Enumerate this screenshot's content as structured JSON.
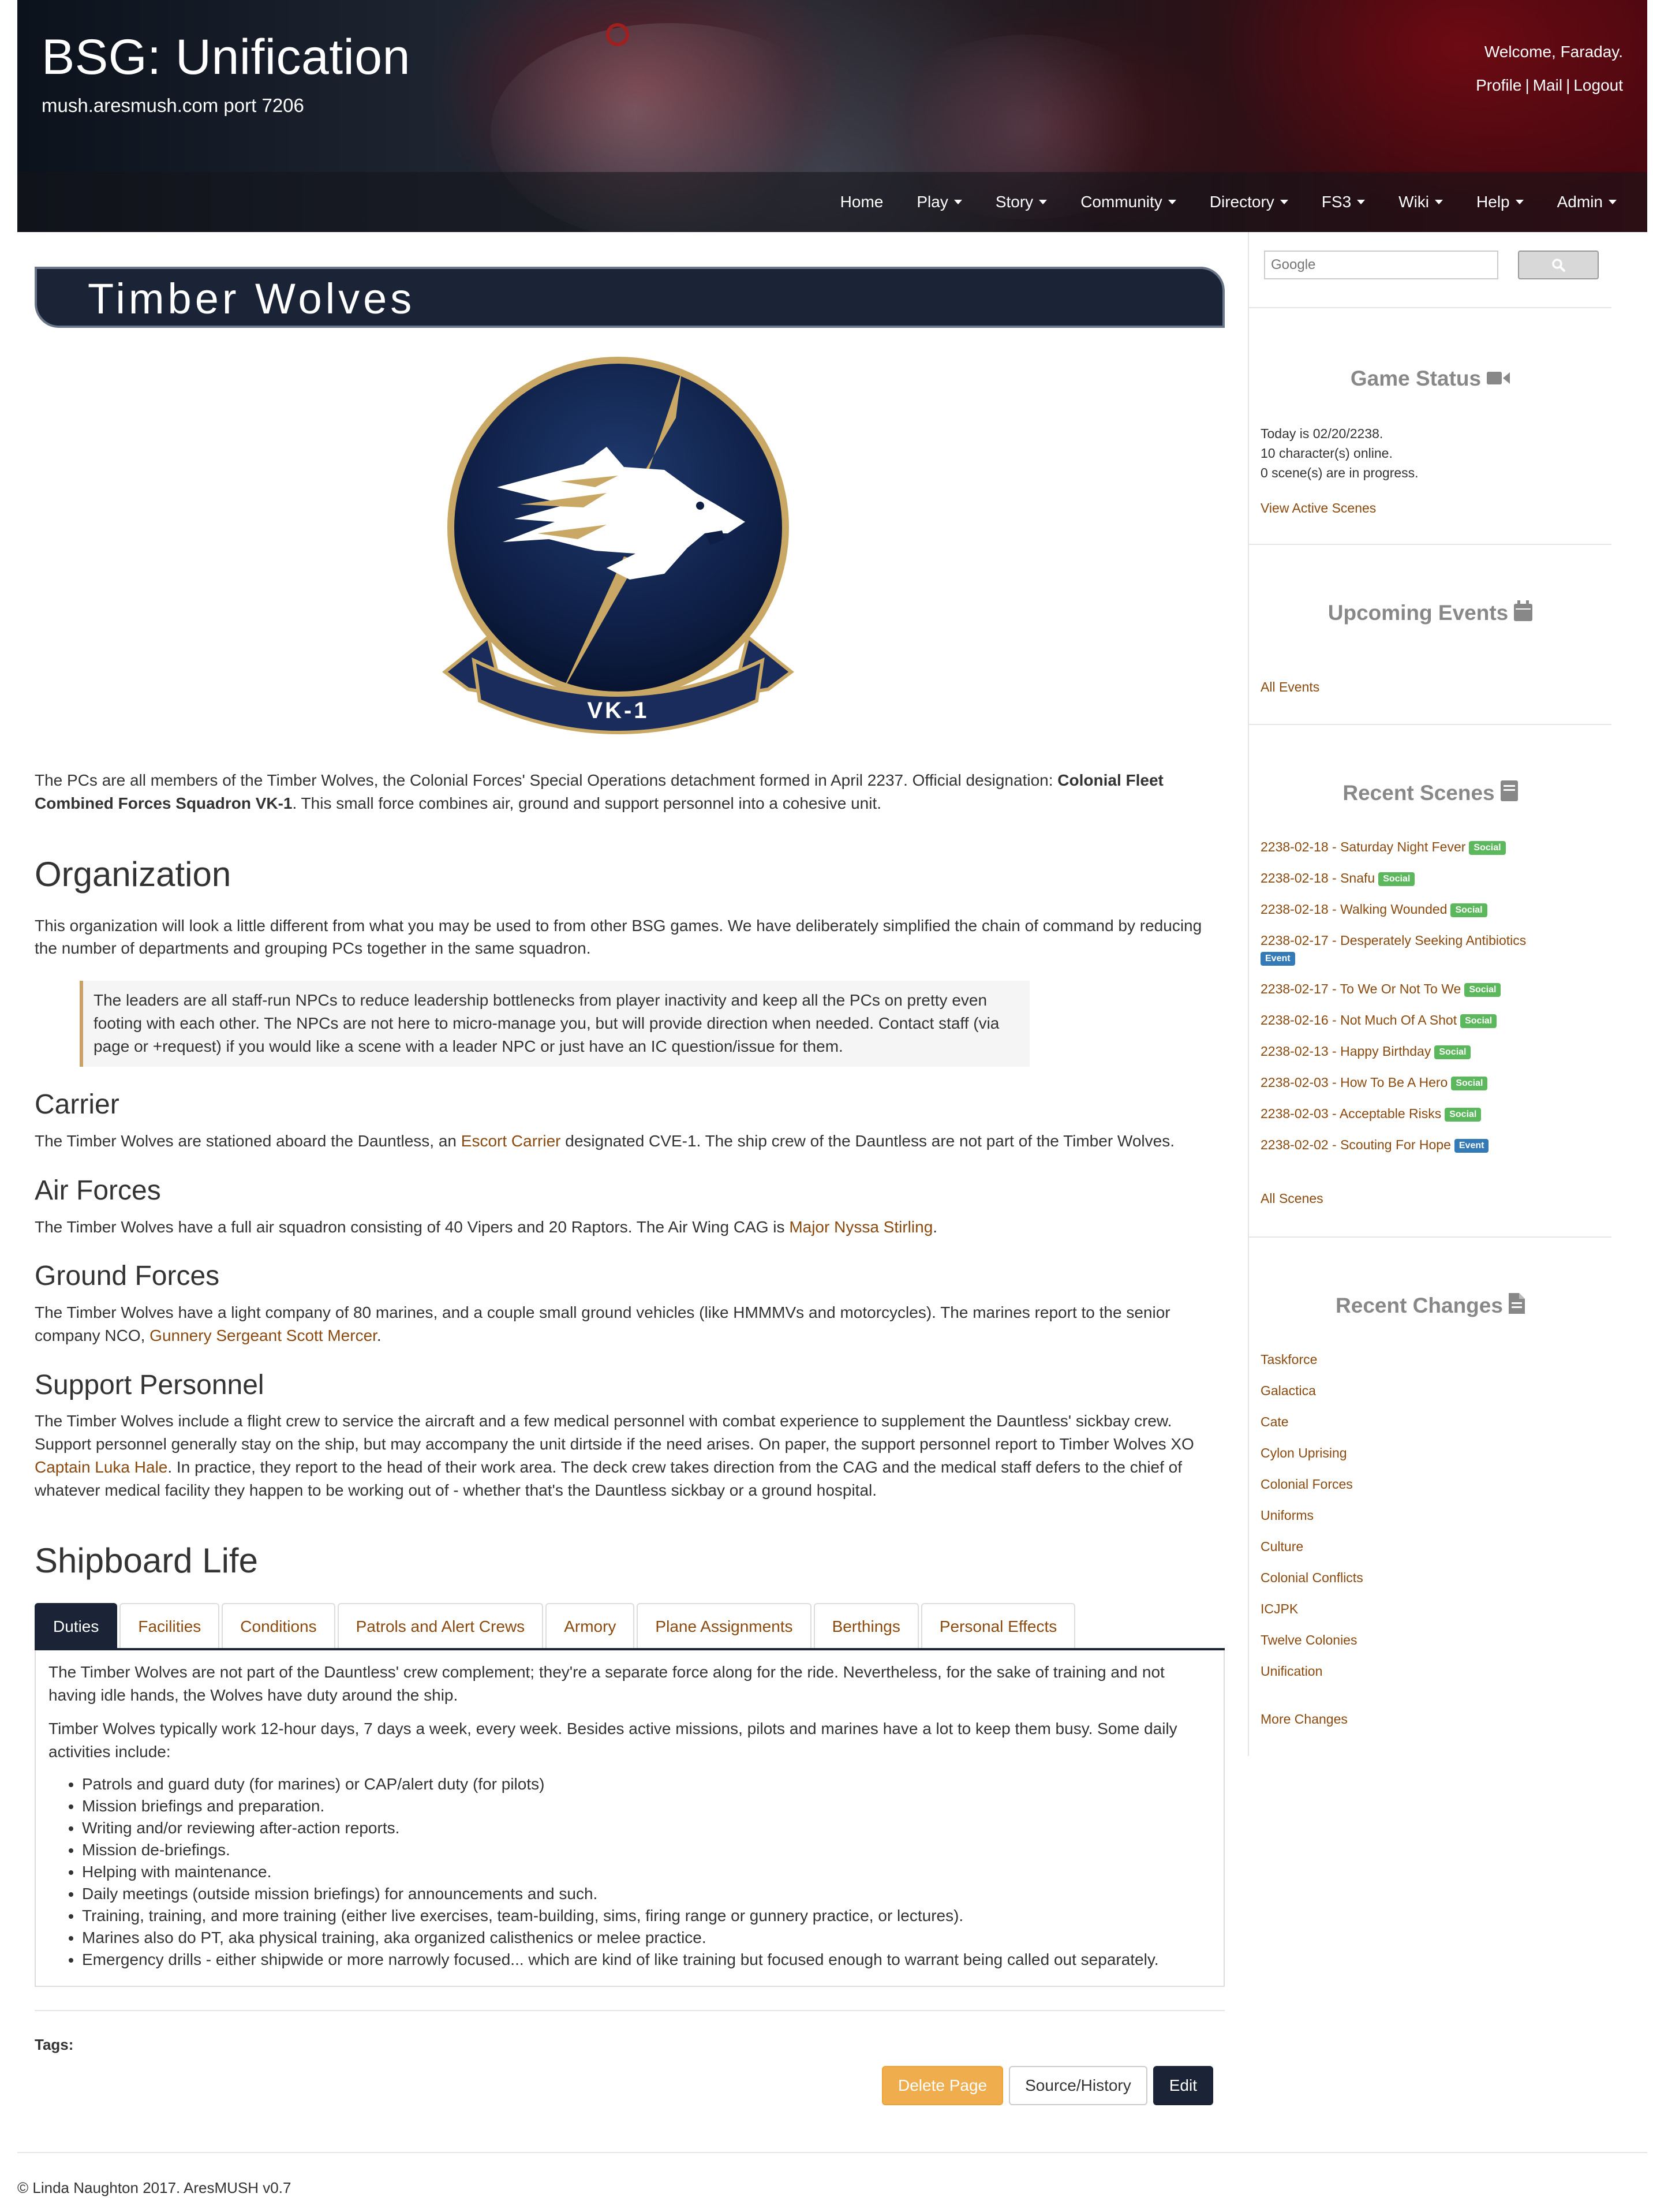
{
  "site": {
    "title": "BSG: Unification",
    "subtitle": "mush.aresmush.com port 7206",
    "welcome": "Welcome, Faraday.",
    "user_links": [
      "Profile",
      "Mail",
      "Logout"
    ]
  },
  "nav": [
    {
      "label": "Home",
      "dropdown": false
    },
    {
      "label": "Play",
      "dropdown": true
    },
    {
      "label": "Story",
      "dropdown": true
    },
    {
      "label": "Community",
      "dropdown": true
    },
    {
      "label": "Directory",
      "dropdown": true
    },
    {
      "label": "FS3",
      "dropdown": true
    },
    {
      "label": "Wiki",
      "dropdown": true
    },
    {
      "label": "Help",
      "dropdown": true
    },
    {
      "label": "Admin",
      "dropdown": true
    }
  ],
  "page": {
    "title": "Timber Wolves",
    "logo_text": "VK-1",
    "intro_pre": "The PCs are all members of the Timber Wolves, the Colonial Forces' Special Operations detachment formed in April 2237. Official designation: ",
    "intro_bold": "Colonial Fleet Combined Forces Squadron VK-1",
    "intro_post": ". This small force combines air, ground and support personnel into a cohesive unit.",
    "organization": {
      "heading": "Organization",
      "text": "This organization will look a little different from what you may be used to from other BSG games. We have deliberately simplified the chain of command by reducing the number of departments and grouping PCs together in the same squadron.",
      "quote": "The leaders are all staff-run NPCs to reduce leadership bottlenecks from player inactivity and keep all the PCs on pretty even footing with each other. The NPCs are not here to micro-manage you, but will provide direction when needed. Contact staff (via page or +request) if you would like a scene with a leader NPC or just have an IC question/issue for them."
    },
    "carrier": {
      "heading": "Carrier",
      "pre": "The Timber Wolves are stationed aboard the Dauntless, an ",
      "link": "Escort Carrier",
      "post": " designated CVE-1. The ship crew of the Dauntless are not part of the Timber Wolves."
    },
    "air": {
      "heading": "Air Forces",
      "pre": "The Timber Wolves have a full air squadron consisting of 40 Vipers and 20 Raptors. The Air Wing CAG is ",
      "link": "Major Nyssa Stirling",
      "post": "."
    },
    "ground": {
      "heading": "Ground Forces",
      "pre": "The Timber Wolves have a light company of 80 marines, and a couple small ground vehicles (like HMMMVs and motorcycles). The marines report to the senior company NCO, ",
      "link": "Gunnery Sergeant Scott Mercer",
      "post": "."
    },
    "support": {
      "heading": "Support Personnel",
      "pre": "The Timber Wolves include a flight crew to service the aircraft and a few medical personnel with combat experience to supplement the Dauntless' sickbay crew. Support personnel generally stay on the ship, but may accompany the unit dirtside if the need arises. On paper, the support personnel report to Timber Wolves XO ",
      "link": "Captain Luka Hale",
      "post": ". In practice, they report to the head of their work area. The deck crew takes direction from the CAG and the medical staff defers to the chief of whatever medical facility they happen to be working out of - whether that's the Dauntless sickbay or a ground hospital."
    },
    "shipboard": {
      "heading": "Shipboard Life",
      "tabs": [
        "Duties",
        "Facilities",
        "Conditions",
        "Patrols and Alert Crews",
        "Armory",
        "Plane Assignments",
        "Berthings",
        "Personal Effects"
      ],
      "active_tab": "Duties",
      "p1": "The Timber Wolves are not part of the Dauntless' crew complement; they're a separate force along for the ride. Nevertheless, for the sake of training and not having idle hands, the Wolves have duty around the ship.",
      "p2": "Timber Wolves typically work 12-hour days, 7 days a week, every week. Besides active missions, pilots and marines have a lot to keep them busy. Some daily activities include:",
      "items": [
        "Patrols and guard duty (for marines) or CAP/alert duty (for pilots)",
        "Mission briefings and preparation.",
        "Writing and/or reviewing after-action reports.",
        "Mission de-briefings.",
        "Helping with maintenance.",
        "Daily meetings (outside mission briefings) for announcements and such.",
        "Training, training, and more training (either live exercises, team-building, sims, firing range or gunnery practice, or lectures).",
        "Marines also do PT, aka physical training, aka organized calisthenics or melee practice.",
        "Emergency drills - either shipwide or more narrowly focused... which are kind of like training but focused enough to warrant being called out separately."
      ]
    },
    "tags_label": "Tags:",
    "buttons": {
      "delete": "Delete Page",
      "source": "Source/History",
      "edit": "Edit"
    }
  },
  "sidebar": {
    "search_placeholder": "Google",
    "game_status": {
      "title": "Game Status",
      "icon": "video-camera-icon",
      "lines": [
        "Today is 02/20/2238.",
        "10 character(s) online.",
        "0 scene(s) are in progress."
      ],
      "link": "View Active Scenes"
    },
    "upcoming_events": {
      "title": "Upcoming Events",
      "icon": "calendar-icon",
      "link": "All Events"
    },
    "recent_scenes": {
      "title": "Recent Scenes",
      "icon": "book-icon",
      "scenes": [
        {
          "title": "2238-02-18 - Saturday Night Fever",
          "badge": "Social"
        },
        {
          "title": "2238-02-18 - Snafu",
          "badge": "Social"
        },
        {
          "title": "2238-02-18 - Walking Wounded",
          "badge": "Social"
        },
        {
          "title": "2238-02-17 - Desperately Seeking Antibiotics",
          "badge": "Event"
        },
        {
          "title": "2238-02-17 - To We Or Not To We",
          "badge": "Social"
        },
        {
          "title": "2238-02-16 - Not Much Of A Shot",
          "badge": "Social"
        },
        {
          "title": "2238-02-13 - Happy Birthday",
          "badge": "Social"
        },
        {
          "title": "2238-02-03 - How To Be A Hero",
          "badge": "Social"
        },
        {
          "title": "2238-02-03 - Acceptable Risks",
          "badge": "Social"
        },
        {
          "title": "2238-02-02 - Scouting For Hope",
          "badge": "Event"
        }
      ],
      "link": "All Scenes"
    },
    "recent_changes": {
      "title": "Recent Changes",
      "icon": "file-icon",
      "items": [
        "Taskforce",
        "Galactica",
        "Cate",
        "Cylon Uprising",
        "Colonial Forces",
        "Uniforms",
        "Culture",
        "Colonial Conflicts",
        "ICJPK",
        "Twelve Colonies",
        "Unification"
      ],
      "link": "More Changes"
    }
  },
  "footer": "© Linda Naughton 2017. AresMUSH v0.7",
  "colors": {
    "navy": "#1b2437",
    "link": "#8b4a0f",
    "social_badge": "#5cb85c",
    "event_badge": "#337ab7",
    "delete_button": "#f0ad4e"
  }
}
